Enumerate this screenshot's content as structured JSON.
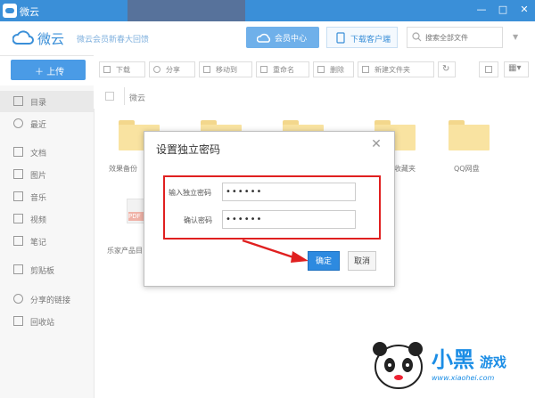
{
  "window": {
    "title": "微云",
    "controls": [
      "minimize-icon",
      "maximize-icon",
      "close-icon"
    ]
  },
  "header": {
    "brand": "微云",
    "promo": "微云会员新春大回馈",
    "vip_button": "会员中心",
    "client_button": "下载客户端",
    "search": {
      "placeholder": "搜索全部文件"
    }
  },
  "upload_button": "上传",
  "sidebar": {
    "items": [
      {
        "label": "目录",
        "icon": "list-icon"
      },
      {
        "label": "最近",
        "icon": "clock-icon"
      },
      {
        "label": "文档",
        "icon": "document-icon"
      },
      {
        "label": "图片",
        "icon": "image-icon"
      },
      {
        "label": "音乐",
        "icon": "music-icon"
      },
      {
        "label": "视频",
        "icon": "video-icon"
      },
      {
        "label": "笔记",
        "icon": "note-icon"
      },
      {
        "label": "剪贴板",
        "icon": "clipboard-icon"
      },
      {
        "label": "分享的链接",
        "icon": "link-icon"
      },
      {
        "label": "回收站",
        "icon": "trash-icon"
      }
    ]
  },
  "toolbar": {
    "download": "下载",
    "share": "分享",
    "move": "移动到",
    "rename": "重命名",
    "delete": "删除",
    "new_folder": "新建文件夹"
  },
  "breadcrumb": {
    "root": "微云"
  },
  "files": [
    {
      "name": "效果备份"
    },
    {
      "name": ""
    },
    {
      "name": ""
    },
    {
      "name": "收藏夹"
    },
    {
      "name": "QQ网盘"
    },
    {
      "name": "乐家产品目"
    }
  ],
  "pdf_badge": "PDF",
  "dialog": {
    "title": "设置独立密码",
    "password_label": "输入独立密码",
    "password_value": "••••••",
    "confirm_label": "确认密码",
    "confirm_value": "••••••",
    "ok_button": "确定",
    "cancel_button": "取消"
  },
  "watermark": {
    "brand": "小黑",
    "game": "游戏",
    "url": "www.xiaohei.com"
  },
  "colors": {
    "accent": "#3a8fd8",
    "ok_button": "#2d8ae0",
    "highlight": "#e02020",
    "folder": "#f9e3a1"
  }
}
